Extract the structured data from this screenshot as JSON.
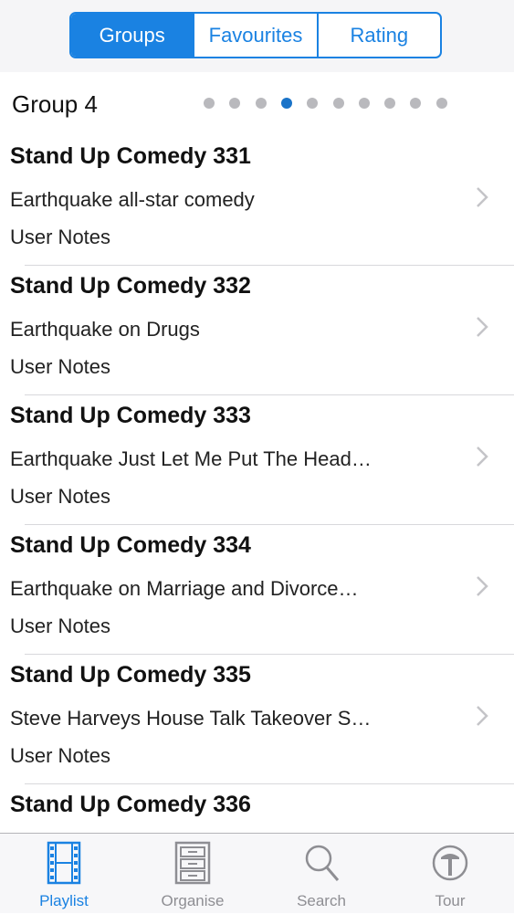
{
  "segments": [
    "Groups",
    "Favourites",
    "Rating"
  ],
  "active_segment": 0,
  "group": {
    "title": "Group 4",
    "page_count": 10,
    "active_page": 4
  },
  "items": [
    {
      "title": "Stand Up Comedy 331",
      "subtitle": "Earthquake all-star comedy",
      "notes": "User Notes"
    },
    {
      "title": "Stand Up Comedy 332",
      "subtitle": "Earthquake on Drugs",
      "notes": "User Notes"
    },
    {
      "title": "Stand Up Comedy 333",
      "subtitle": "Earthquake Just Let Me Put The Head…",
      "notes": "User Notes"
    },
    {
      "title": "Stand Up Comedy 334",
      "subtitle": "Earthquake on Marriage and Divorce…",
      "notes": "User Notes"
    },
    {
      "title": "Stand Up Comedy 335",
      "subtitle": "Steve Harveys House Talk Takeover S…",
      "notes": "User Notes"
    },
    {
      "title": "Stand Up Comedy 336",
      "subtitle": "",
      "notes": ""
    }
  ],
  "tabs": [
    {
      "label": "Playlist",
      "icon": "film-strip-icon"
    },
    {
      "label": "Organise",
      "icon": "file-cabinet-icon"
    },
    {
      "label": "Search",
      "icon": "magnifier-icon"
    },
    {
      "label": "Tour",
      "icon": "tour-icon"
    }
  ],
  "active_tab": 0,
  "colors": {
    "accent": "#1a82e2",
    "inactive": "#8e8e93",
    "separator": "#d8d8dc"
  }
}
